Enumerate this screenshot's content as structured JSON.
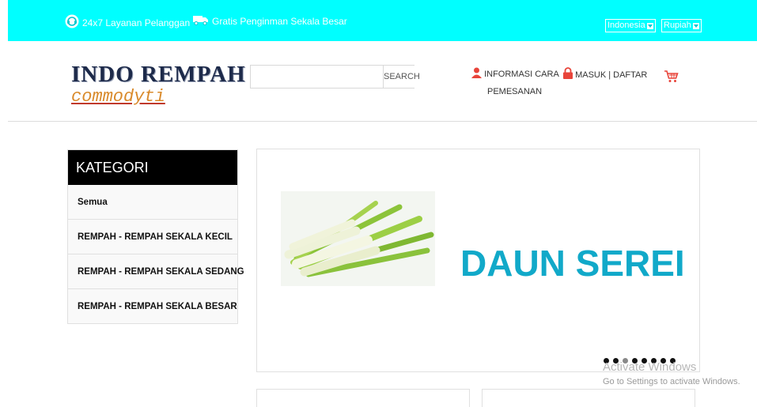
{
  "topbar": {
    "support_icon": "headset-icon",
    "support_label": "24x7 Layanan Pelanggan",
    "shipping_icon": "truck-icon",
    "shipping_label": "Gratis Penginman Sekala Besar",
    "language_selected": "Indonesia",
    "currency_selected": "Rupiah",
    "bg_color": "#00ffff"
  },
  "header": {
    "logo_title": "INDO REMPAH",
    "logo_subtitle": "commodyti",
    "search_placeholder": "",
    "search_button": "SEARCH",
    "info_link_line1": "INFORMASI CARA",
    "info_link_line2": "PEMESANAN",
    "info_icon": "user-icon",
    "login_link": "MASUK | DAFTAR",
    "login_icon": "lock-icon",
    "cart_icon": "cart-icon",
    "accent_color": "#e8443a"
  },
  "sidebar": {
    "title": "KATEGORI",
    "items": [
      {
        "label": "Semua"
      },
      {
        "label": "REMPAH - REMPAH SEKALA KECIL"
      },
      {
        "label": "REMPAH - REMPAH SEKALA SEDANG"
      },
      {
        "label": "REMPAH - REMPAH SEKALA BESAR"
      }
    ]
  },
  "slider": {
    "caption": "DAUN SEREI",
    "image": "lemongrass-image",
    "caption_color": "#11a9c9",
    "dot_count": 8,
    "active_dot": 3
  },
  "watermark": {
    "line1": "Activate Windows",
    "line2": "Go to Settings to activate Windows."
  }
}
